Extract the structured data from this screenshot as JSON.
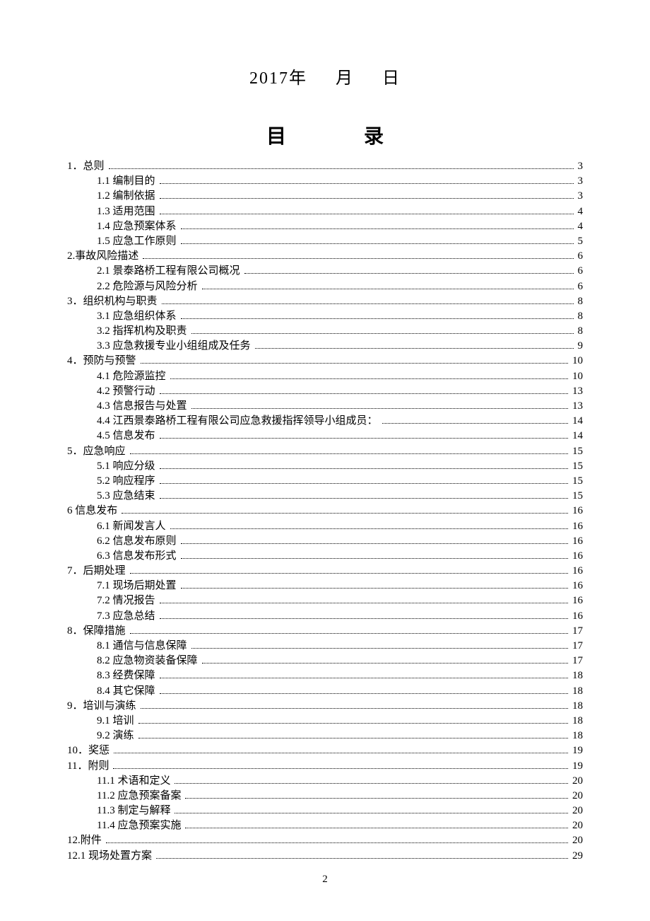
{
  "date": {
    "year": "2017",
    "year_suffix": "年",
    "month_suffix": "月",
    "day_suffix": "日"
  },
  "toc_title_left": "目",
  "toc_title_right": "录",
  "page_number": "2",
  "toc": [
    {
      "level": 1,
      "label": "1．总则",
      "page": "3"
    },
    {
      "level": 2,
      "label": "1.1 编制目的",
      "page": "3"
    },
    {
      "level": 2,
      "label": "1.2 编制依据",
      "page": "3"
    },
    {
      "level": 2,
      "label": "1.3 适用范围",
      "page": "4"
    },
    {
      "level": 2,
      "label": "1.4 应急预案体系",
      "page": "4"
    },
    {
      "level": 2,
      "label": "1.5 应急工作原则",
      "page": "5"
    },
    {
      "level": 1,
      "label": "2.事故风险描述",
      "page": "6"
    },
    {
      "level": 2,
      "label": "2.1 景泰路桥工程有限公司概况",
      "page": "6"
    },
    {
      "level": 2,
      "label": "2.2 危险源与风险分析",
      "page": "6"
    },
    {
      "level": 1,
      "label": "3．组织机构与职责",
      "page": "8"
    },
    {
      "level": 2,
      "label": "3.1 应急组织体系",
      "page": "8"
    },
    {
      "level": 2,
      "label": "3.2 指挥机构及职责",
      "page": "8"
    },
    {
      "level": 2,
      "label": "3.3 应急救援专业小组组成及任务",
      "page": "9"
    },
    {
      "level": 1,
      "label": "4．预防与预警",
      "page": "10"
    },
    {
      "level": 2,
      "label": "4.1 危险源监控",
      "page": "10"
    },
    {
      "level": 2,
      "label": "4.2 预警行动",
      "page": "13"
    },
    {
      "level": 2,
      "label": "4.3 信息报告与处置",
      "page": "13"
    },
    {
      "level": 2,
      "label": "4.4 江西景泰路桥工程有限公司应急救援指挥领导小组成员：",
      "page": "14"
    },
    {
      "level": 2,
      "label": "4.5 信息发布",
      "page": "14"
    },
    {
      "level": 1,
      "label": "5．应急响应",
      "page": "15"
    },
    {
      "level": 2,
      "label": "5.1 响应分级",
      "page": "15"
    },
    {
      "level": 2,
      "label": "5.2 响应程序",
      "page": "15"
    },
    {
      "level": 2,
      "label": "5.3 应急结束",
      "page": "15"
    },
    {
      "level": 1,
      "label": "6  信息发布",
      "page": "16"
    },
    {
      "level": 2,
      "label": "6.1 新闻发言人",
      "page": "16"
    },
    {
      "level": 2,
      "label": "6.2  信息发布原则",
      "page": "16"
    },
    {
      "level": 2,
      "label": "6.3  信息发布形式",
      "page": "16"
    },
    {
      "level": 1,
      "label": "7．后期处理",
      "page": "16"
    },
    {
      "level": 2,
      "label": "7.1  现场后期处置",
      "page": "16"
    },
    {
      "level": 2,
      "label": "7.2  情况报告",
      "page": "16"
    },
    {
      "level": 2,
      "label": "7.3  应急总结",
      "page": "16"
    },
    {
      "level": 1,
      "label": "8．保障措施",
      "page": "17"
    },
    {
      "level": 2,
      "label": "8.1 通信与信息保障",
      "page": "17"
    },
    {
      "level": 2,
      "label": "8.2 应急物资装备保障",
      "page": "17"
    },
    {
      "level": 2,
      "label": "8.3 经费保障",
      "page": "18"
    },
    {
      "level": 2,
      "label": "8.4 其它保障",
      "page": "18"
    },
    {
      "level": 1,
      "label": "9．培训与演练",
      "page": "18"
    },
    {
      "level": 2,
      "label": "9.1 培训",
      "page": "18"
    },
    {
      "level": 2,
      "label": "9.2 演练",
      "page": "18"
    },
    {
      "level": 1,
      "label": "10．奖惩",
      "page": "19"
    },
    {
      "level": 1,
      "label": "11．附则",
      "page": "19"
    },
    {
      "level": 2,
      "label": "11.1 术语和定义",
      "page": "20"
    },
    {
      "level": 2,
      "label": "11.2 应急预案备案",
      "page": "20"
    },
    {
      "level": 2,
      "label": "11.3 制定与解释",
      "page": "20"
    },
    {
      "level": 2,
      "label": "11.4 应急预案实施",
      "page": "20"
    },
    {
      "level": 1,
      "label": "12.附件",
      "page": "20"
    },
    {
      "level": 1,
      "label": "12.1 现场处置方案",
      "page": "29"
    }
  ]
}
